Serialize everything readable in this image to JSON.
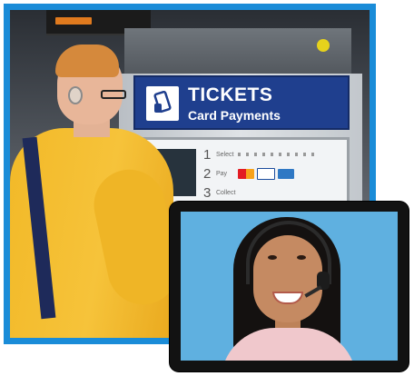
{
  "machine": {
    "title": "TICKETS",
    "subtitle": "Card Payments",
    "steps": [
      {
        "number": "1",
        "label": "Select"
      },
      {
        "number": "2",
        "label": "Pay"
      },
      {
        "number": "3",
        "label": "Collect"
      }
    ],
    "card_brands": [
      "mastercard-logo",
      "visa-logo",
      "amex-logo"
    ]
  },
  "icons": {
    "ticket": "ticket-card-icon",
    "headset": "headset-icon"
  },
  "colors": {
    "frame_blue": "#1a8cd8",
    "panel_navy": "#1f3f8e",
    "tablet_screen": "#5fb0e0",
    "hoodie_yellow": "#f6c33a"
  }
}
